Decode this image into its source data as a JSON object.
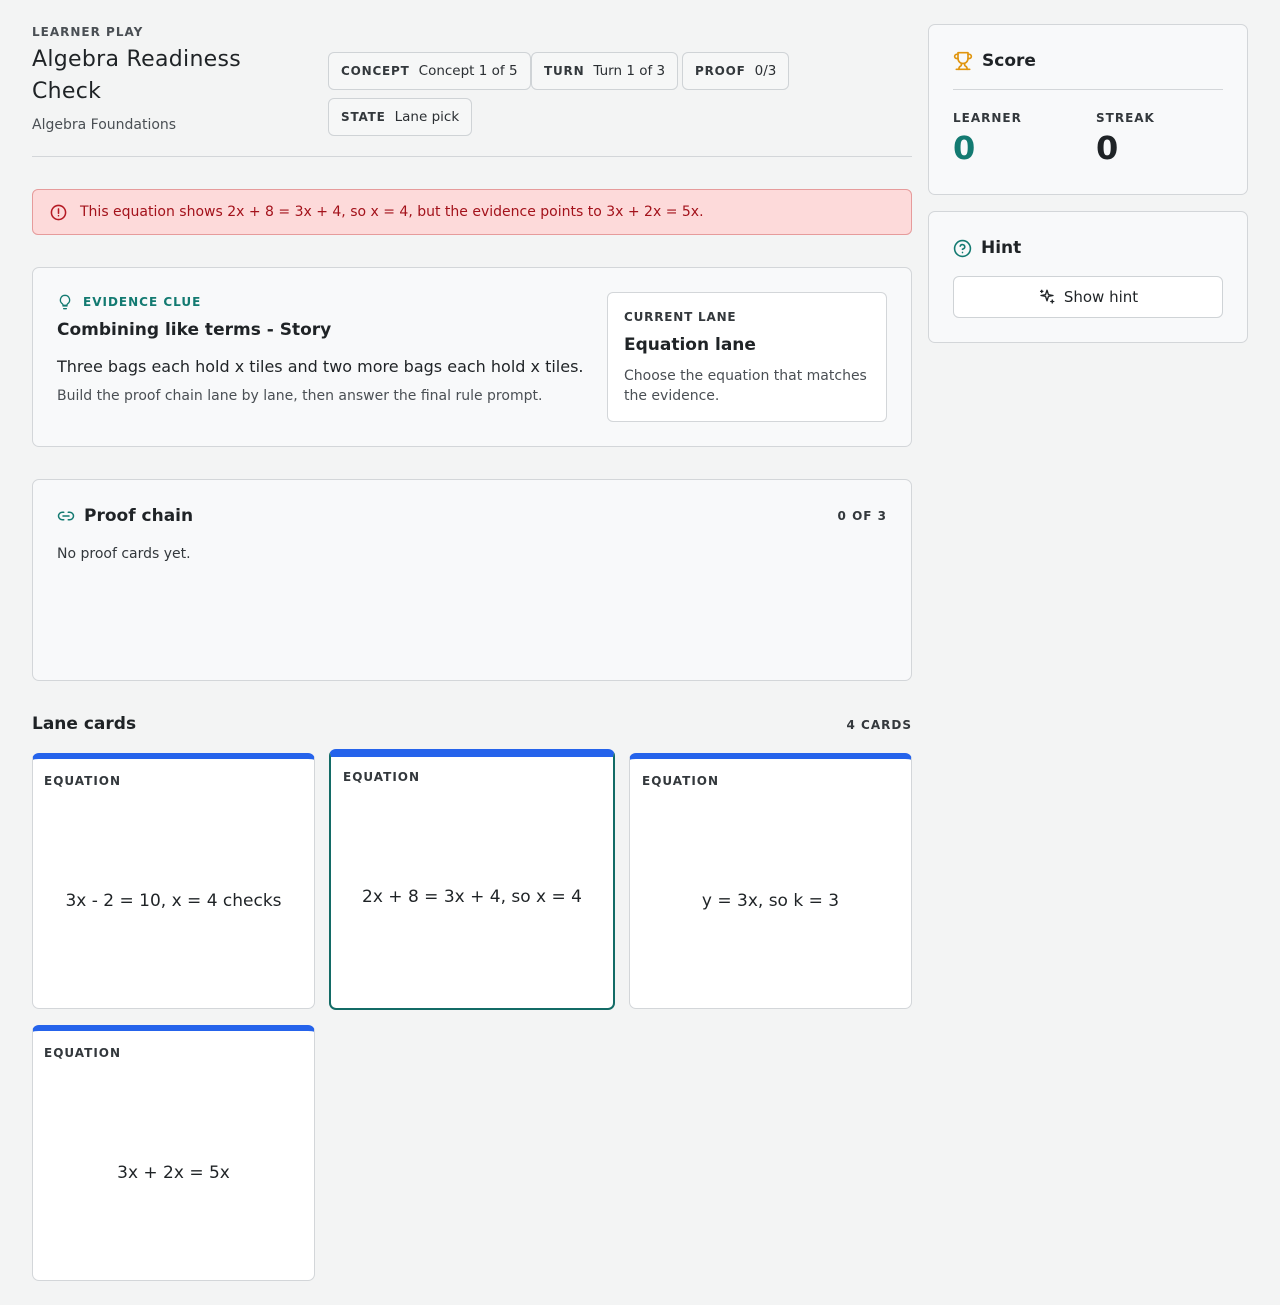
{
  "header": {
    "eyebrow": "LEARNER PLAY",
    "title": "Algebra Readiness Check",
    "subtitle": "Algebra Foundations"
  },
  "chips": [
    {
      "key": "CONCEPT",
      "value": "Concept 1 of 5"
    },
    {
      "key": "TURN",
      "value": "Turn 1 of 3"
    },
    {
      "key": "PROOF",
      "value": "0/3"
    },
    {
      "key": "STATE",
      "value": "Lane pick"
    }
  ],
  "alert": {
    "message": "This equation shows 2x + 8 = 3x + 4, so x = 4, but the evidence points to 3x + 2x = 5x.",
    "color": "#a3121b"
  },
  "evidence": {
    "label": "EVIDENCE CLUE",
    "title": "Combining like terms - Story",
    "body": "Three bags each hold x tiles and two more bags each hold x tiles.",
    "note": "Build the proof chain lane by lane, then answer the final rule prompt.",
    "current_lane": {
      "label": "CURRENT LANE",
      "title": "Equation lane",
      "description": "Choose the equation that matches the evidence."
    }
  },
  "proof_chain": {
    "title": "Proof chain",
    "count": "0 OF 3",
    "empty": "No proof cards yet."
  },
  "lane_cards": {
    "title": "Lane cards",
    "count": "4 CARDS",
    "accent": "#2563eb",
    "selected_border": "#136b66",
    "cards": [
      {
        "kind": "EQUATION",
        "text": "3x - 2 = 10, x = 4 checks",
        "selected": false
      },
      {
        "kind": "EQUATION",
        "text": "2x + 8 = 3x + 4, so x = 4",
        "selected": true
      },
      {
        "kind": "EQUATION",
        "text": "y = 3x, so k = 3",
        "selected": false
      },
      {
        "kind": "EQUATION",
        "text": "3x + 2x = 5x",
        "selected": false
      }
    ]
  },
  "score": {
    "title": "Score",
    "learner_label": "LEARNER",
    "learner_value": "0",
    "streak_label": "STREAK",
    "streak_value": "0",
    "learner_color": "#137a71",
    "icon": "trophy-icon"
  },
  "hint": {
    "title": "Hint",
    "button": "Show hint",
    "icon": "help-circle-icon"
  }
}
